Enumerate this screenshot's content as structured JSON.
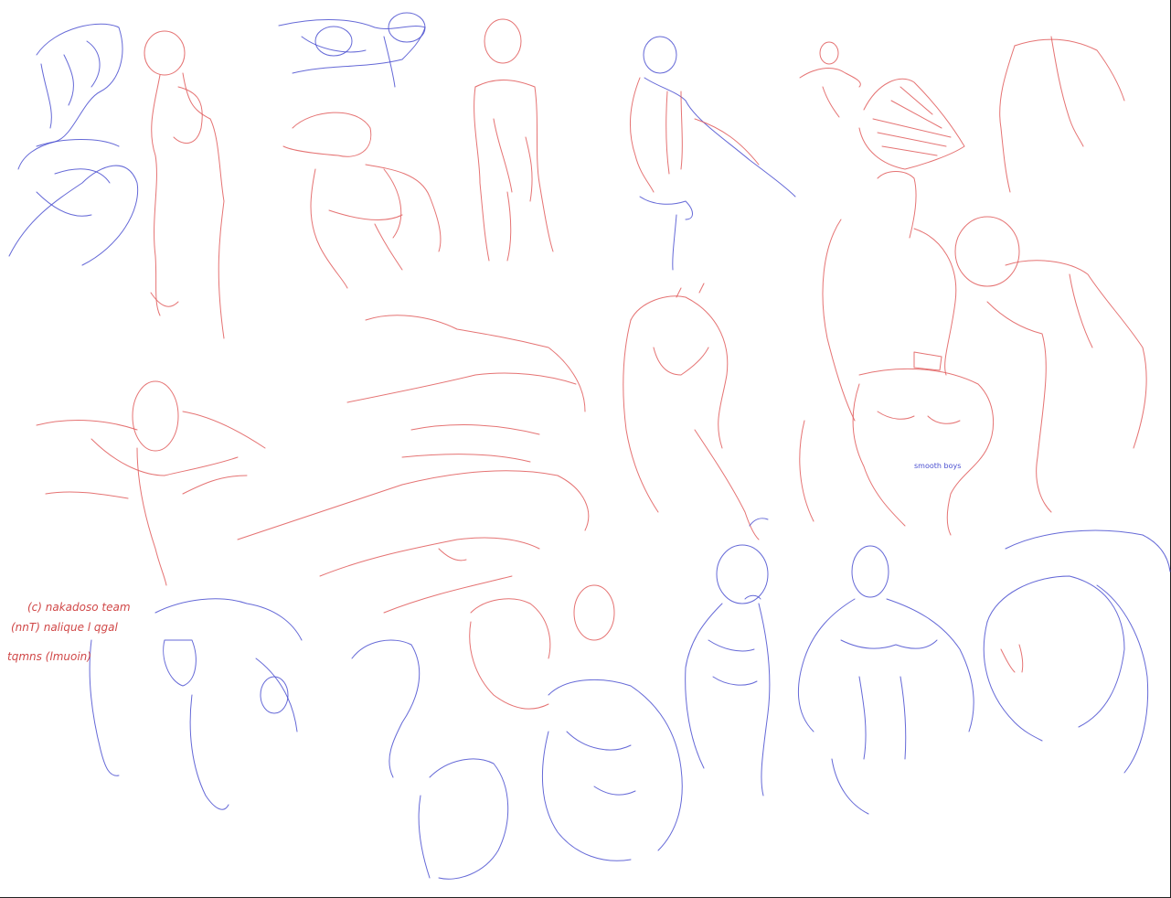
{
  "page": {
    "background": "#ffffff"
  },
  "palette": {
    "red_pencil": "#e05a5a",
    "blue_pencil": "#4a4fd0"
  },
  "notes": {
    "handwriting_line1": "(c) nakadoso team",
    "handwriting_line2": "(nnT) nalique l qgal",
    "handwriting_line3": "tqmns (lmuoin)",
    "small_label": "smooth boys"
  }
}
